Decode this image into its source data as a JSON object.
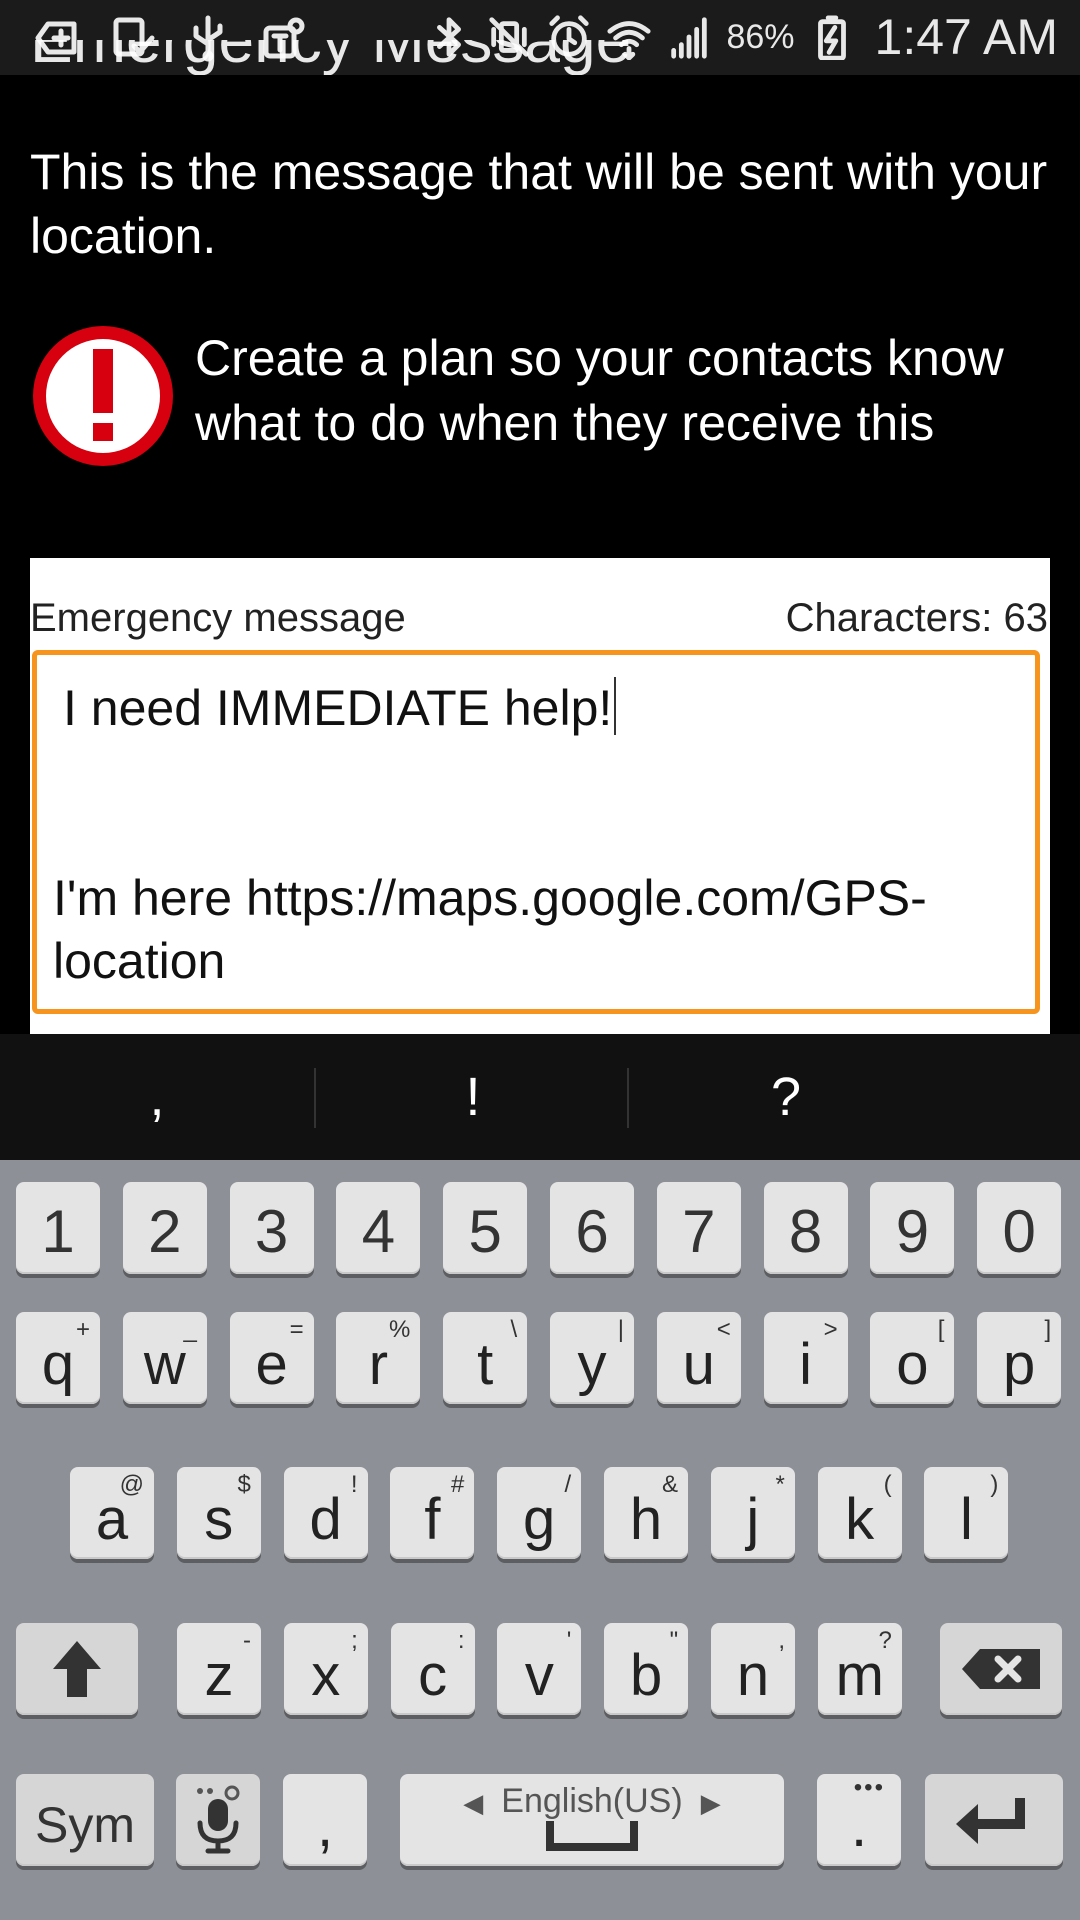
{
  "status_bar": {
    "battery": "86%",
    "time": "1:47 AM",
    "left_icons": [
      "add-notification-icon",
      "phone-check-icon",
      "usb-icon",
      "tmobile-icon"
    ],
    "right_icons": [
      "bluetooth-icon",
      "vibrate-mute-icon",
      "alarm-icon",
      "wifi-icon",
      "signal-icon",
      "battery-charging-icon"
    ]
  },
  "page": {
    "title_clipped": "Emergency Message",
    "description": "This is the message that will be sent with your location.",
    "warning_text": "Create a plan so your contacts know what to do when they receive this"
  },
  "message": {
    "label": "Emergency message",
    "char_count": "Characters: 63",
    "line1": "I need IMMEDIATE help!",
    "line2": "I'm here https://maps.google.com/GPS-location"
  },
  "suggestions": [
    ",",
    "!",
    "?"
  ],
  "keyboard": {
    "numbers": [
      "1",
      "2",
      "3",
      "4",
      "5",
      "6",
      "7",
      "8",
      "9",
      "0"
    ],
    "row1": [
      {
        "k": "q",
        "s": "+"
      },
      {
        "k": "w",
        "s": "_"
      },
      {
        "k": "e",
        "s": "="
      },
      {
        "k": "r",
        "s": "%"
      },
      {
        "k": "t",
        "s": "\\"
      },
      {
        "k": "y",
        "s": "|"
      },
      {
        "k": "u",
        "s": "<"
      },
      {
        "k": "i",
        "s": ">"
      },
      {
        "k": "o",
        "s": "["
      },
      {
        "k": "p",
        "s": "]"
      }
    ],
    "row2": [
      {
        "k": "a",
        "s": "@"
      },
      {
        "k": "s",
        "s": "$"
      },
      {
        "k": "d",
        "s": "!"
      },
      {
        "k": "f",
        "s": "#"
      },
      {
        "k": "g",
        "s": "/"
      },
      {
        "k": "h",
        "s": "&"
      },
      {
        "k": "j",
        "s": "*"
      },
      {
        "k": "k",
        "s": "("
      },
      {
        "k": "l",
        "s": ")"
      }
    ],
    "row3": [
      {
        "k": "z",
        "s": "-"
      },
      {
        "k": "x",
        "s": ";"
      },
      {
        "k": "c",
        "s": ":"
      },
      {
        "k": "v",
        "s": "'"
      },
      {
        "k": "b",
        "s": "\""
      },
      {
        "k": "n",
        "s": ","
      },
      {
        "k": "m",
        "s": "?"
      }
    ],
    "sym_label": "Sym",
    "comma": ",",
    "space_lang": "English(US)",
    "period": ".",
    "shift_icon": "shift-arrow-icon",
    "backspace_icon": "backspace-icon",
    "mic_icon": "microphone-icon",
    "enter_icon": "enter-icon"
  },
  "colors": {
    "accent": "#f7941d",
    "warning_red": "#d6000f",
    "keyboard_bg": "#8d9096",
    "key_bg": "#e4e4e4"
  }
}
